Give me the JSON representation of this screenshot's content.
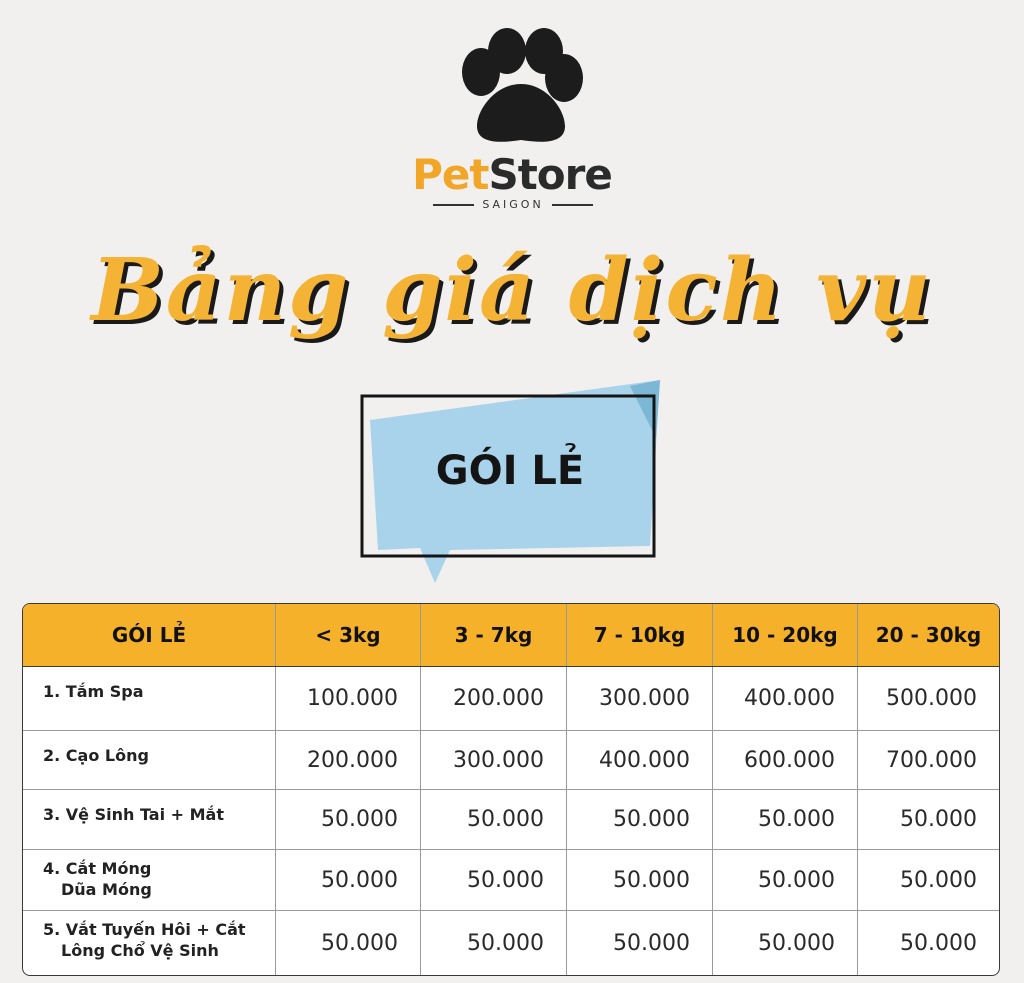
{
  "brand": {
    "name_part1": "Pet",
    "name_part2": "Store",
    "subtitle": "SAIGON",
    "logo_icon": "paw-icon"
  },
  "headline": "Bảng giá dịch vụ",
  "banner": {
    "label": "GÓI LẺ"
  },
  "colors": {
    "accent": "#f6b12a",
    "banner_blue": "#a9d3ea",
    "text_dark": "#141414",
    "background": "#f1f0ef"
  },
  "table": {
    "headers": [
      "GÓI LẺ",
      "< 3kg",
      "3 - 7kg",
      "7 - 10kg",
      "10 - 20kg",
      "20 - 30kg"
    ],
    "rows": [
      {
        "service": "1. Tắm Spa",
        "prices": [
          "100.000",
          "200.000",
          "300.000",
          "400.000",
          "500.000"
        ]
      },
      {
        "service": "2. Cạo Lông",
        "prices": [
          "200.000",
          "300.000",
          "400.000",
          "600.000",
          "700.000"
        ]
      },
      {
        "service": "3. Vệ Sinh Tai + Mắt",
        "prices": [
          "50.000",
          "50.000",
          "50.000",
          "50.000",
          "50.000"
        ]
      },
      {
        "service_line1": "4. Cắt Móng",
        "service_line2": "Dũa Móng",
        "prices": [
          "50.000",
          "50.000",
          "50.000",
          "50.000",
          "50.000"
        ]
      },
      {
        "service_line1": "5. Vắt Tuyến Hôi + Cắt",
        "service_line2": "Lông Chổ Vệ Sinh",
        "prices": [
          "50.000",
          "50.000",
          "50.000",
          "50.000",
          "50.000"
        ]
      }
    ]
  }
}
